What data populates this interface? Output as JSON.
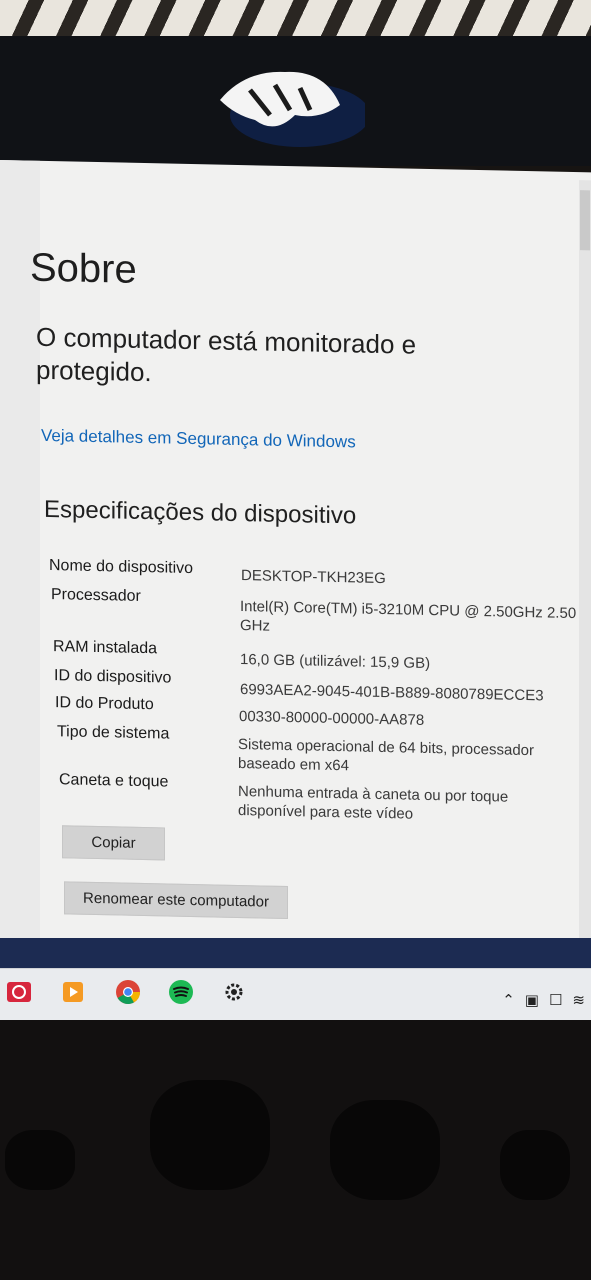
{
  "window": {
    "page_title": "Sobre",
    "status_text": "O computador está monitorado e protegido.",
    "security_link": "Veja detalhes em Segurança do Windows"
  },
  "specs": {
    "section_title": "Especificações do dispositivo",
    "rows": [
      {
        "label": "Nome do dispositivo",
        "value": "DESKTOP-TKH23EG"
      },
      {
        "label": "Processador",
        "value": "Intel(R) Core(TM) i5-3210M CPU @ 2.50GHz 2.50 GHz"
      },
      {
        "label": "RAM instalada",
        "value": "16,0 GB (utilizável: 15,9 GB)"
      },
      {
        "label": "ID do dispositivo",
        "value": "6993AEA2-9045-401B-B889-8080789ECCE3"
      },
      {
        "label": "ID do Produto",
        "value": "00330-80000-00000-AA878"
      },
      {
        "label": "Tipo de sistema",
        "value": "Sistema operacional de 64 bits, processador baseado em x64"
      },
      {
        "label": "Caneta e toque",
        "value": "Nenhuma entrada à caneta ou por toque disponível para este vídeo"
      }
    ]
  },
  "buttons": {
    "copy": "Copiar",
    "rename": "Renomear este computador"
  },
  "taskbar": {
    "apps": [
      "app-icon",
      "media-player-icon",
      "chrome-icon",
      "spotify-icon",
      "settings-gear-icon"
    ],
    "tray": [
      "chevron-up-icon",
      "display-icon",
      "network-icon",
      "wifi-icon"
    ]
  },
  "colors": {
    "link": "#1266b8",
    "window_bg": "#f1f1f0",
    "button_bg": "#d2d2d2"
  }
}
